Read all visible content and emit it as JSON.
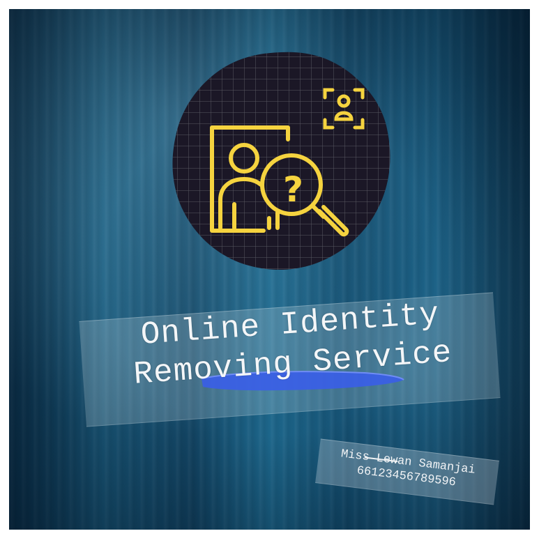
{
  "poster": {
    "title_line1": "Online Identity",
    "title_line2": "Removing Service",
    "name": "Miss Lewan Samanjai",
    "phone": "66123456789596"
  },
  "icons": {
    "badge": "magnifier-question-person-icon",
    "profile": "user-focus-icon"
  },
  "colors": {
    "background": "#134b6b",
    "badge": "#1b1726",
    "icon_yellow": "#f5d33f",
    "highlight": "#3a5ee8",
    "text": "#f4f6f8"
  }
}
